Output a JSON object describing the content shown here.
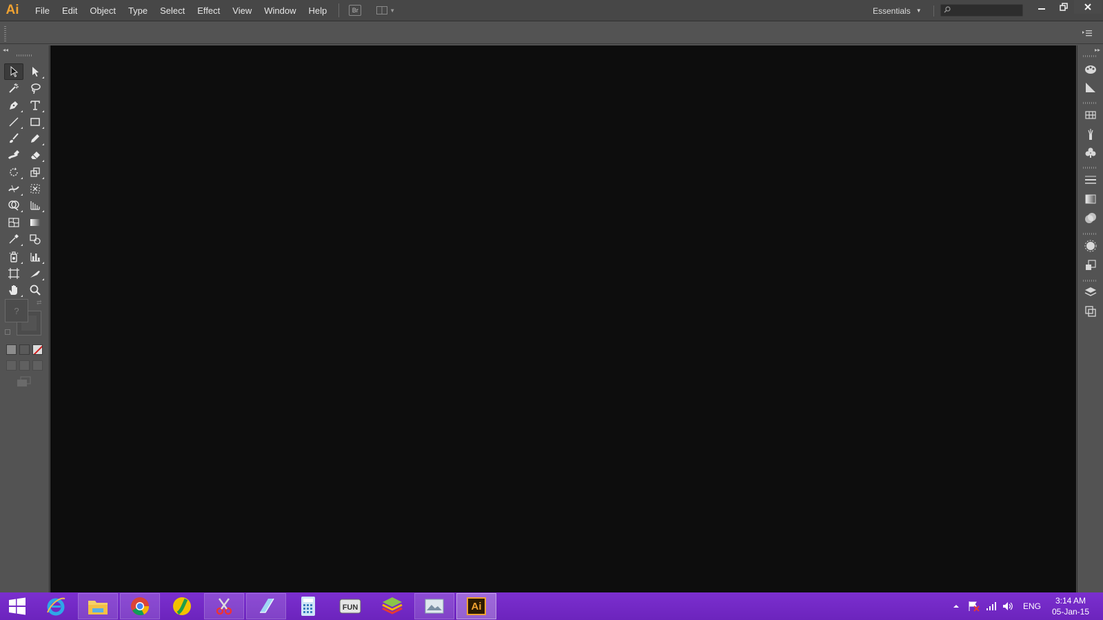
{
  "app": {
    "logo_text": "Ai",
    "menu": [
      "File",
      "Edit",
      "Object",
      "Type",
      "Select",
      "Effect",
      "View",
      "Window",
      "Help"
    ],
    "bridge_label": "Br",
    "workspace": "Essentials",
    "search_placeholder": "",
    "accent": "#f0a231"
  },
  "toolbar": {
    "tools": [
      {
        "name": "selection-tool-icon",
        "active": true
      },
      {
        "name": "direct-selection-tool-icon"
      },
      {
        "name": "magic-wand-tool-icon"
      },
      {
        "name": "lasso-tool-icon"
      },
      {
        "name": "pen-tool-icon"
      },
      {
        "name": "type-tool-icon"
      },
      {
        "name": "line-segment-tool-icon"
      },
      {
        "name": "rectangle-tool-icon"
      },
      {
        "name": "paintbrush-tool-icon"
      },
      {
        "name": "pencil-tool-icon"
      },
      {
        "name": "blob-brush-tool-icon"
      },
      {
        "name": "eraser-tool-icon"
      },
      {
        "name": "rotate-tool-icon"
      },
      {
        "name": "scale-tool-icon"
      },
      {
        "name": "width-tool-icon"
      },
      {
        "name": "free-transform-tool-icon"
      },
      {
        "name": "shape-builder-tool-icon"
      },
      {
        "name": "perspective-grid-tool-icon"
      },
      {
        "name": "mesh-tool-icon"
      },
      {
        "name": "gradient-tool-icon"
      },
      {
        "name": "eyedropper-tool-icon"
      },
      {
        "name": "blend-tool-icon"
      },
      {
        "name": "symbol-sprayer-tool-icon"
      },
      {
        "name": "column-graph-tool-icon"
      },
      {
        "name": "artboard-tool-icon"
      },
      {
        "name": "slice-tool-icon"
      },
      {
        "name": "hand-tool-icon"
      },
      {
        "name": "zoom-tool-icon"
      }
    ],
    "fill_placeholder": "?",
    "stroke_placeholder": "?"
  },
  "dock": {
    "icons": [
      "color-icon",
      "color-guide-icon",
      "swatches-icon",
      "brushes-icon",
      "symbols-icon",
      "stroke-icon",
      "gradient-icon",
      "transparency-icon",
      "appearance-icon",
      "graphic-styles-icon",
      "layers-icon",
      "artboards-icon"
    ]
  },
  "taskbar": {
    "apps": [
      "internet-explorer-icon",
      "file-explorer-icon",
      "chrome-icon",
      "app-green-icon",
      "snipping-tool-icon",
      "notepad-icon",
      "calculator-icon",
      "fun-app-icon",
      "bluestacks-icon",
      "photo-app-icon",
      "illustrator-icon"
    ],
    "illustrator_label": "Ai",
    "fun_label": "FUN",
    "language": "ENG",
    "time": "3:14 AM",
    "date": "05-Jan-15",
    "color": "#7b2fcf"
  }
}
